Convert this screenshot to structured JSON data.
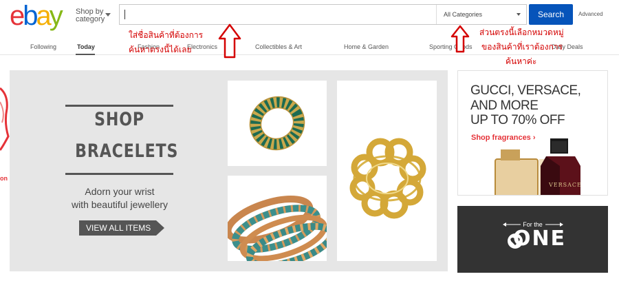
{
  "header": {
    "logo": "ebay",
    "shop_by_line1": "Shop by",
    "shop_by_line2": "category",
    "search_value": "",
    "category_select": "All Categories",
    "search_button": "Search",
    "advanced_link": "Advanced"
  },
  "nav": {
    "items": [
      "Following",
      "Today",
      "Fashion",
      "Electronics",
      "Collectibles & Art",
      "Home & Garden",
      "Sporting Goods",
      "Daily Deals"
    ],
    "active": "Today"
  },
  "annotations": {
    "search_note_line1": "ใส่ชื่อสินค้าที่ต้องการ",
    "search_note_line2": "ค้นหาตรงนี้ได้เลย",
    "category_note_line1": "ส่วนตรงนี้เลือกหมวดหมู่",
    "category_note_line2": "ของสินค้าที่เราต้องการ",
    "category_note_line3": "ค้นหาค่ะ",
    "color": "#d40000"
  },
  "hero": {
    "title_line1": "SHOP",
    "title_line2": "BRACELETS",
    "subtitle_line1": "Adorn your wrist",
    "subtitle_line2": "with beautiful jewellery",
    "cta": "VIEW ALL ITEMS"
  },
  "left_edge_text": "on",
  "ads": {
    "fragrance": {
      "line1": "GUCCI, VERSACE,",
      "line2": "AND MORE",
      "line3": "UP TO 70% OFF",
      "link": "Shop fragrances ›",
      "bottle_label": "VERSACE"
    },
    "for_the_one": {
      "small": "For the",
      "big": "ONE"
    }
  },
  "colors": {
    "search_button": "#0654ba",
    "accent_red": "#e53238",
    "hero_bg": "#e6e6e6",
    "dark_ad": "#333333"
  }
}
